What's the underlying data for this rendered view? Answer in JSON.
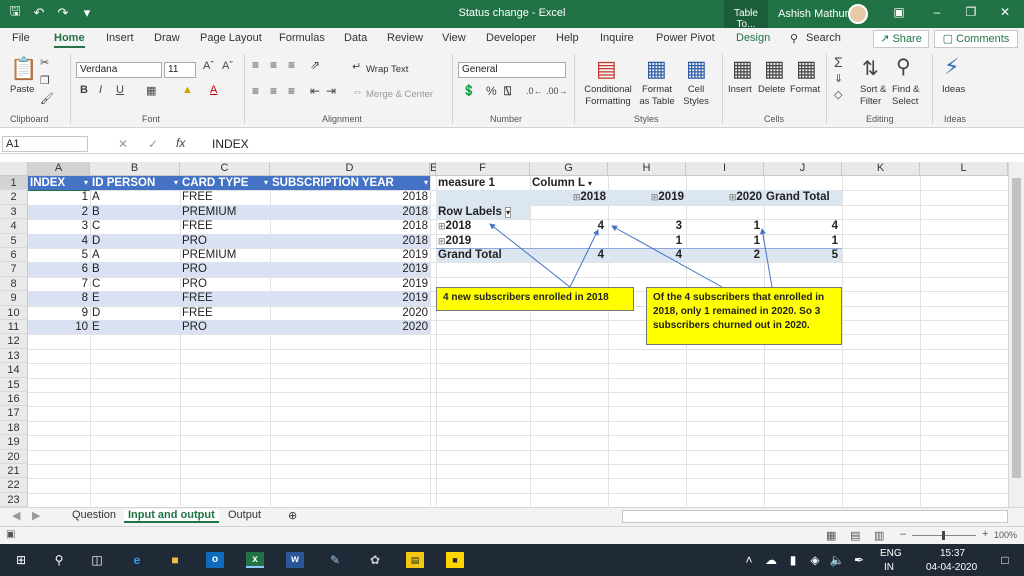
{
  "titlebar": {
    "title": "Status change  -  Excel",
    "context_tab": "Table To...",
    "user": "Ashish Mathur"
  },
  "ribbon_tabs": [
    "File",
    "Home",
    "Insert",
    "Draw",
    "Page Layout",
    "Formulas",
    "Data",
    "Review",
    "View",
    "Developer",
    "Help",
    "Inquire",
    "Power Pivot",
    "Design",
    "Search"
  ],
  "share_label": "Share",
  "comments_label": "Comments",
  "ribbon": {
    "paste": "Paste",
    "font_name": "Verdana",
    "font_size": "11",
    "wrap_text": "Wrap Text",
    "merge_center": "Merge & Center",
    "number_format": "General",
    "conditional_formatting": "Conditional Formatting",
    "format_as_table": "Format as Table",
    "cell_styles": "Cell Styles",
    "insert": "Insert",
    "delete": "Delete",
    "format": "Format",
    "sort_filter": "Sort & Filter",
    "find_select": "Find & Select",
    "ideas": "Ideas",
    "groups": [
      "Clipboard",
      "Font",
      "Alignment",
      "Number",
      "Styles",
      "Cells",
      "Editing",
      "Ideas"
    ]
  },
  "formula_bar": {
    "name_box": "A1",
    "fx": "fx",
    "formula": "INDEX"
  },
  "columns": [
    "A",
    "B",
    "C",
    "D",
    "E",
    "F",
    "G",
    "H",
    "I",
    "J",
    "K",
    "L"
  ],
  "rows": [
    "1",
    "2",
    "3",
    "4",
    "5",
    "6",
    "7",
    "8",
    "9",
    "10",
    "11",
    "12",
    "13",
    "14",
    "15",
    "16",
    "17",
    "18",
    "19",
    "20",
    "21",
    "22",
    "23"
  ],
  "table": {
    "headers": [
      "INDEX",
      "ID PERSON",
      "CARD TYPE",
      "SUBSCRIPTION YEAR"
    ],
    "rows": [
      [
        "1",
        "A",
        "FREE",
        "2018"
      ],
      [
        "2",
        "B",
        "PREMIUM",
        "2018"
      ],
      [
        "3",
        "C",
        "FREE",
        "2018"
      ],
      [
        "4",
        "D",
        "PRO",
        "2018"
      ],
      [
        "5",
        "A",
        "PREMIUM",
        "2019"
      ],
      [
        "6",
        "B",
        "PRO",
        "2019"
      ],
      [
        "7",
        "C",
        "PRO",
        "2019"
      ],
      [
        "8",
        "E",
        "FREE",
        "2019"
      ],
      [
        "9",
        "D",
        "FREE",
        "2020"
      ],
      [
        "10",
        "E",
        "PRO",
        "2020"
      ]
    ]
  },
  "pivot": {
    "measure": "measure 1",
    "column_labels": "Column L",
    "col_2018": "2018",
    "col_2019": "2019",
    "col_2020": "2020",
    "grand_total_col": "Grand Total",
    "row_labels": "Row Labels",
    "r2018": {
      "label": "2018",
      "v2018": "4",
      "v2019": "3",
      "v2020": "1",
      "total": "4"
    },
    "r2019": {
      "label": "2019",
      "v2018": "",
      "v2019": "1",
      "v2020": "1",
      "total": "1"
    },
    "grand": {
      "label": "Grand Total",
      "v2018": "4",
      "v2019": "4",
      "v2020": "2",
      "total": "5"
    }
  },
  "callouts": {
    "left": "4 new subscribers enrolled in 2018",
    "right": "Of the 4 subscribers that enrolled in 2018, only 1 remained in 2020.  So 3 subscribers churned out in 2020."
  },
  "sheet_tabs": [
    "Question",
    "Input and output",
    "Output"
  ],
  "status": {
    "zoom": "100%"
  },
  "taskbar": {
    "lang": "ENG",
    "region": "IN",
    "time": "15:37",
    "date": "04-04-2020"
  }
}
